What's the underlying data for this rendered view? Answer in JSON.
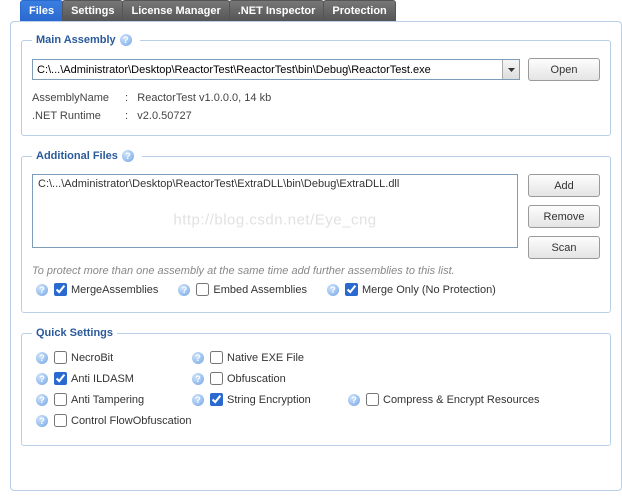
{
  "tabs": {
    "files": "Files",
    "settings": "Settings",
    "license": "License Manager",
    "net": ".NET Inspector",
    "protection": "Protection"
  },
  "main_assembly": {
    "legend": "Main Assembly",
    "path": "C:\\...\\Administrator\\Desktop\\ReactorTest\\ReactorTest\\bin\\Debug\\ReactorTest.exe",
    "open": "Open",
    "asm_label": "AssemblyName",
    "asm_value": "ReactorTest  v1.0.0.0,  14 kb",
    "rt_label": ".NET Runtime",
    "rt_value": "v2.0.50727"
  },
  "additional": {
    "legend": "Additional Files",
    "items": [
      "C:\\...\\Administrator\\Desktop\\ReactorTest\\ExtraDLL\\bin\\Debug\\ExtraDLL.dll"
    ],
    "add": "Add",
    "remove": "Remove",
    "scan": "Scan",
    "note": "To protect more than one assembly at the same time add further assemblies to this list.",
    "merge": "MergeAssemblies",
    "embed": "Embed Assemblies",
    "merge_only": "Merge Only (No Protection)",
    "watermark": "http://blog.csdn.net/Eye_cng",
    "states": {
      "merge": true,
      "embed": false,
      "merge_only": true
    }
  },
  "quick": {
    "legend": "Quick Settings",
    "items": {
      "necrobit": {
        "label": "NecroBit",
        "checked": false
      },
      "anti_ildasm": {
        "label": "Anti ILDASM",
        "checked": true
      },
      "anti_tamper": {
        "label": "Anti Tampering",
        "checked": false
      },
      "cfo": {
        "label": "Control FlowObfuscation",
        "checked": false
      },
      "native": {
        "label": "Native EXE File",
        "checked": false
      },
      "obf": {
        "label": "Obfuscation",
        "checked": false
      },
      "strenc": {
        "label": "String Encryption",
        "checked": true
      },
      "compenc": {
        "label": "Compress & Encrypt Resources",
        "checked": false
      }
    }
  }
}
